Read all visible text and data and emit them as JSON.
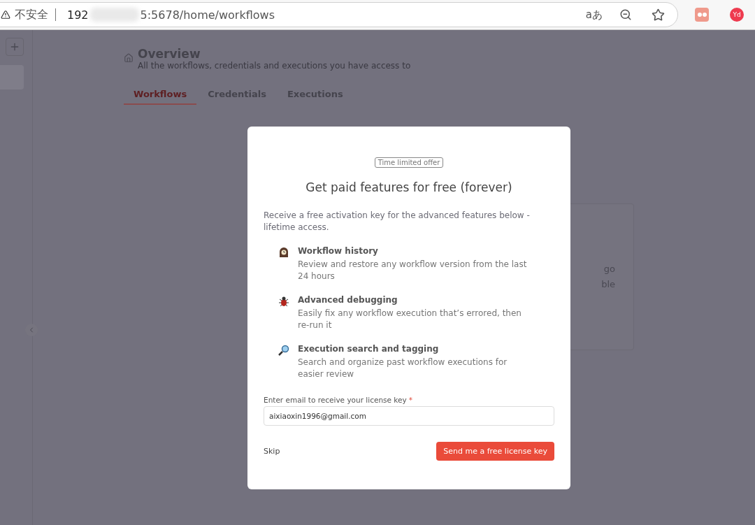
{
  "browser": {
    "security_label": "不安全",
    "url_start": "192",
    "url_end": "5:5678/home/workflows",
    "translate_label": "aあ",
    "extension_badge": "Yd"
  },
  "sidebar": {
    "items": [
      {
        "selected": true
      }
    ]
  },
  "header": {
    "title": "Overview",
    "subtitle": "All the workflows, credentials and executions you have access to"
  },
  "tabs": [
    {
      "label": "Workflows",
      "selected": true
    },
    {
      "label": "Credentials",
      "selected": false
    },
    {
      "label": "Executions",
      "selected": false
    }
  ],
  "background_card": {
    "lines": [
      "go",
      "ble"
    ]
  },
  "modal": {
    "badge": "Time limited offer",
    "title": "Get paid features for free (forever)",
    "description": "Receive a free activation key for the advanced features below - lifetime access.",
    "features": [
      {
        "kind": "clock",
        "title": "Workflow history",
        "text": "Review and restore any workflow version from the last 24 hours"
      },
      {
        "kind": "bug",
        "title": "Advanced debugging",
        "text": "Easily fix any workflow execution that’s errored, then re-run it"
      },
      {
        "kind": "search",
        "title": "Execution search and tagging",
        "text": "Search and organize past workflow executions for easier review"
      }
    ],
    "email_label": "Enter email to receive your license key",
    "required_mark": "*",
    "email_value": "aixiaoxin1996@gmail.com",
    "skip": "Skip",
    "submit": "Send me a free license key"
  }
}
